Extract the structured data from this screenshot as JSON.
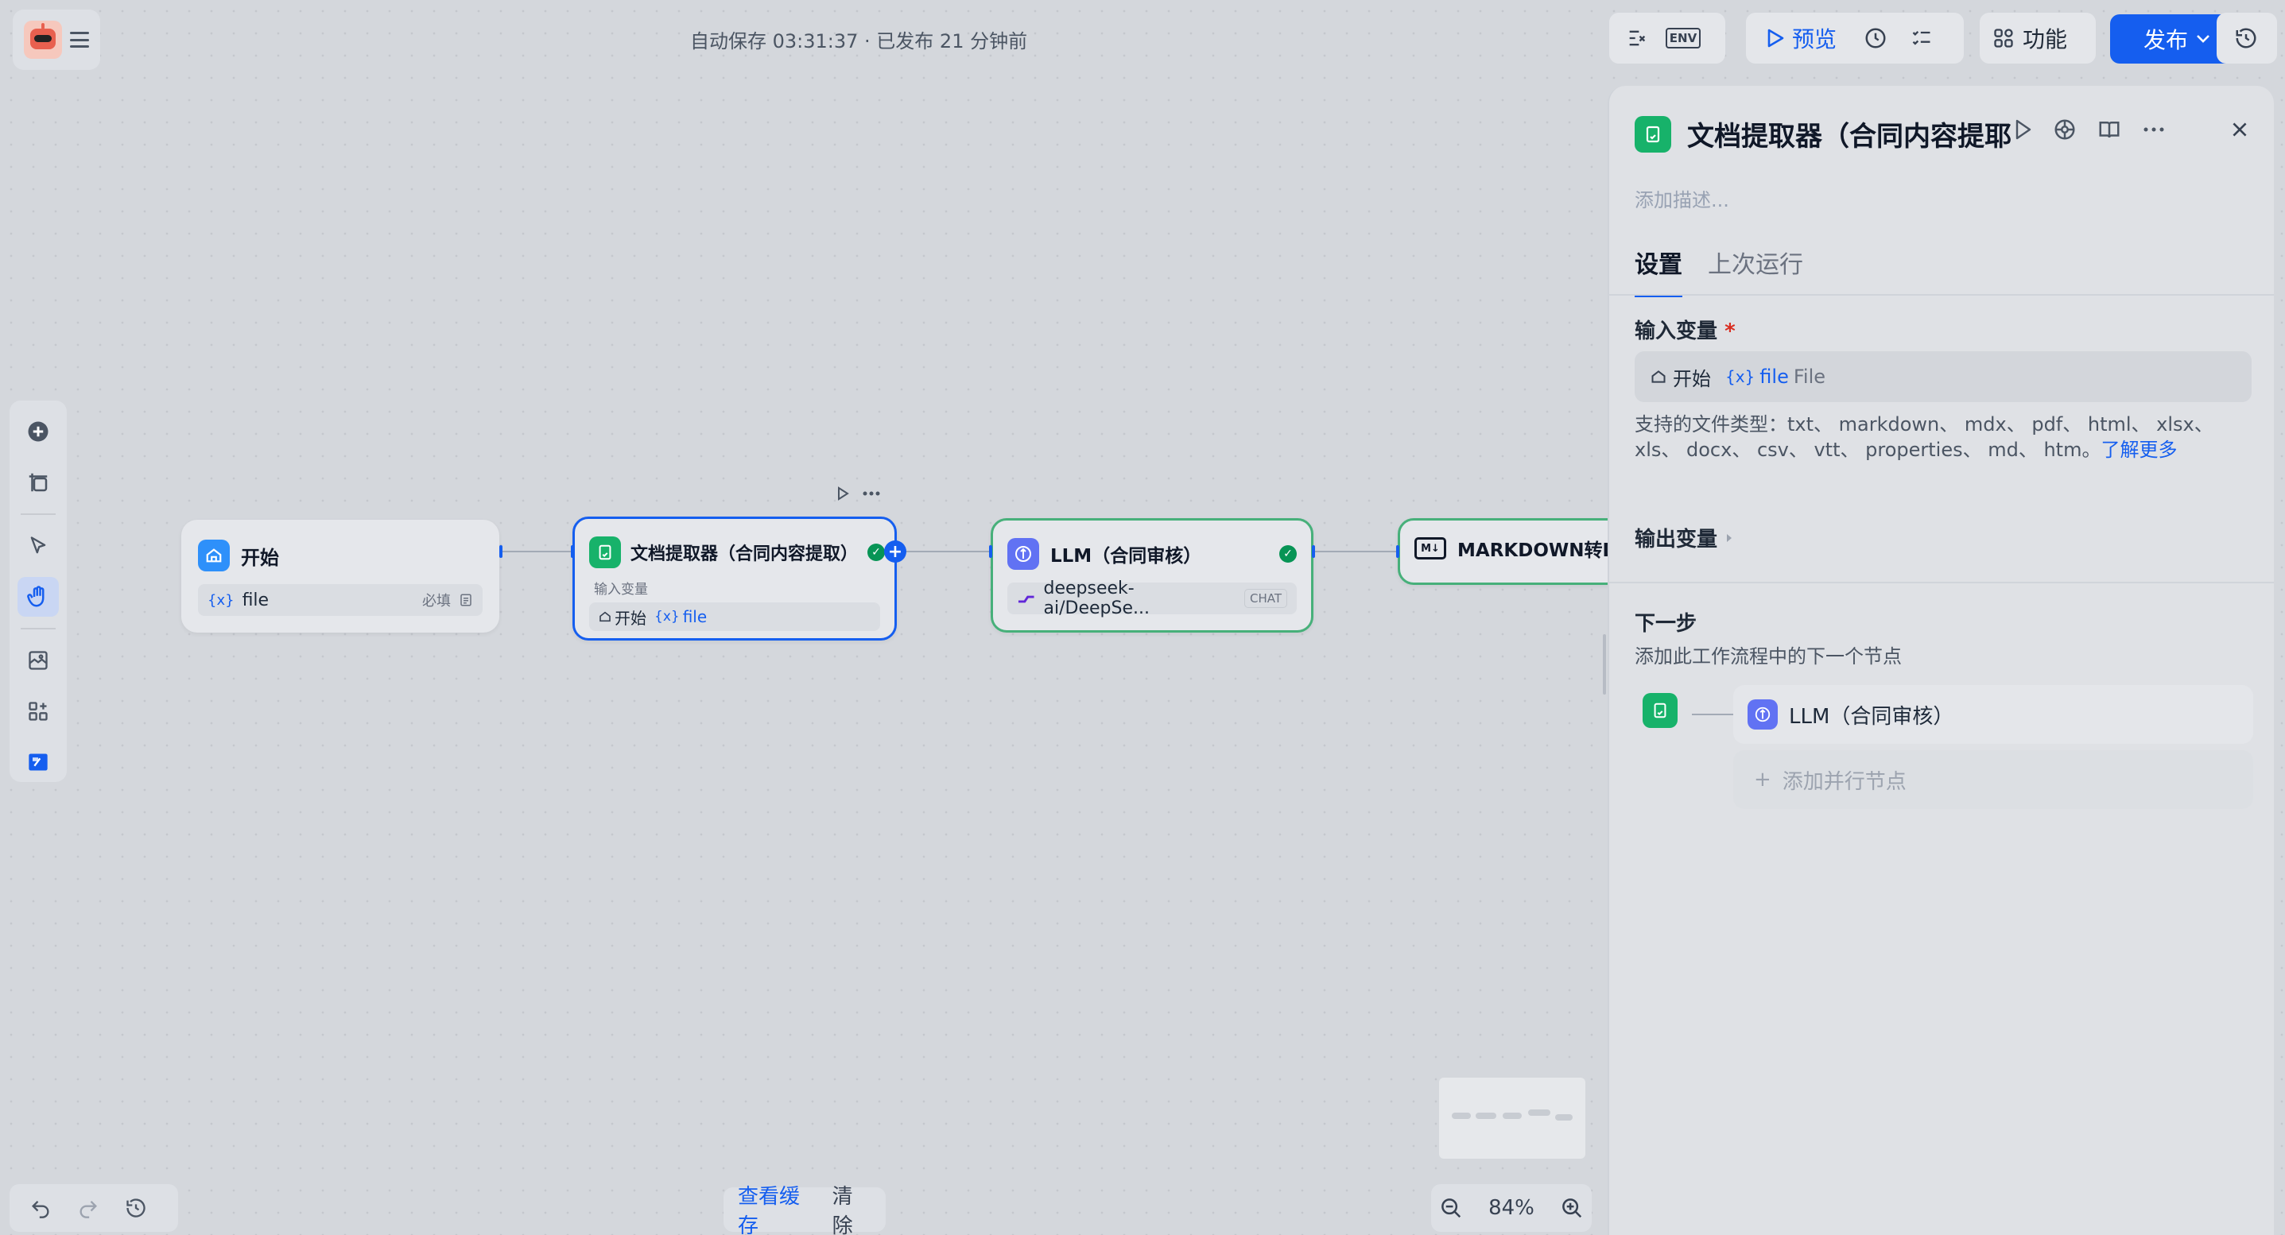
{
  "topbar": {
    "autosave": "自动保存 03:31:37 · 已发布 21 分钟前",
    "preview_label": "预览",
    "features_label": "功能",
    "publish_label": "发布",
    "env_label": "ENV"
  },
  "nodes": {
    "start": {
      "title": "开始",
      "var_prefix": "{x}",
      "var_name": "file",
      "required": "必填"
    },
    "extractor": {
      "title": "文档提取器（合同内容提取）",
      "input_label": "输入变量",
      "source": "开始",
      "var_prefix": "{x}",
      "var_name": "file"
    },
    "llm": {
      "title": "LLM（合同审核）",
      "model": "deepseek-ai/DeepSe...",
      "mode": "CHAT"
    },
    "markdown": {
      "title": "MARKDOWN转D"
    }
  },
  "panel": {
    "title": "文档提取器（合同内容提耶",
    "description_placeholder": "添加描述...",
    "tabs": [
      "设置",
      "上次运行"
    ],
    "input_var_label": "输入变量",
    "required_mark": "*",
    "input_source": "开始",
    "input_var_prefix": "{x}",
    "input_var_name": "file",
    "input_var_type": "File",
    "supported_text": "支持的文件类型：txt、 markdown、 mdx、 pdf、 html、 xlsx、 xls、 docx、 csv、 vtt、 properties、 md、 htm。",
    "learn_more": "了解更多",
    "output_var_label": "输出变量",
    "next_step_label": "下一步",
    "next_step_desc": "添加此工作流程中的下一个节点",
    "next_node": "LLM（合同审核）",
    "add_parallel": "添加并行节点",
    "add_parallel_plus": "+"
  },
  "bottom": {
    "view_cache": "查看缓存",
    "clear": "清除",
    "zoom": "84%"
  },
  "colors": {
    "accent": "#155eef",
    "success": "#079455",
    "extractor_icon": "#17b26a",
    "llm_icon": "#6172f3"
  }
}
